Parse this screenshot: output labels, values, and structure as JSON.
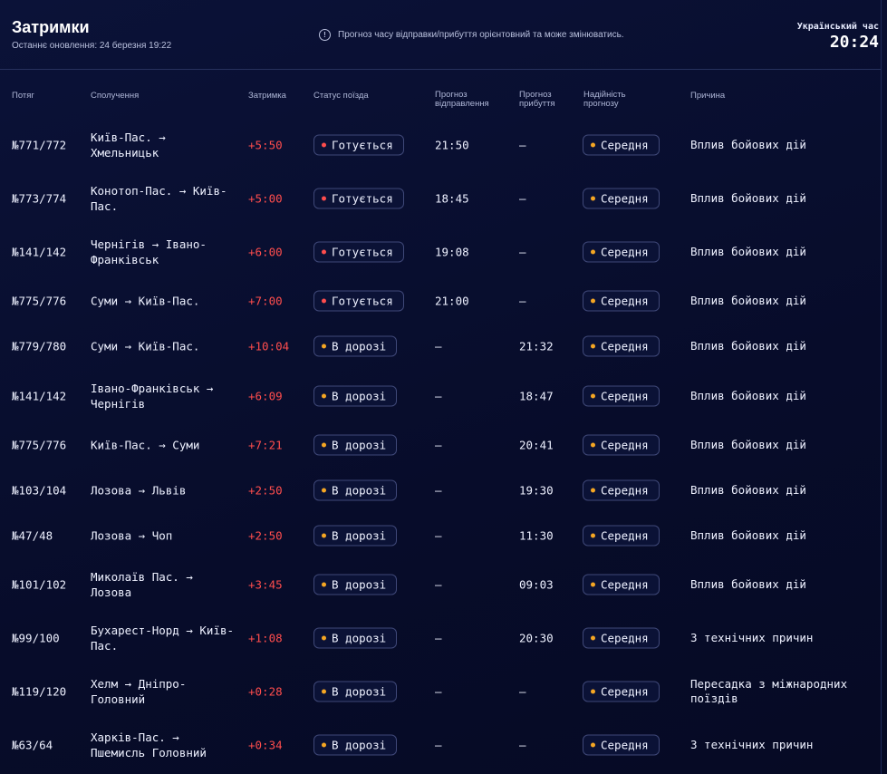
{
  "header": {
    "title": "Затримки",
    "updated": "Останнє оновлення: 24 березня 19:22",
    "notice": "Прогноз часу відправки/прибуття орієнтовний та може змінюватись.",
    "clock_label": "Український час",
    "clock_time": "20:24"
  },
  "columns": {
    "train": "Потяг",
    "route": "Сполучення",
    "delay": "Затримка",
    "status": "Статус поїзда",
    "departure": "Прогноз відправлення",
    "arrival": "Прогноз прибуття",
    "reliability": "Надійність прогнозу",
    "reason": "Причина"
  },
  "colors": {
    "status_preparing_dot": "#ff4d4d",
    "status_enroute_dot": "#f5a623",
    "reliability_dot": "#f5a623",
    "delay_text": "#ff4d4d",
    "background": "#070c2a"
  },
  "rows": [
    {
      "train": "№771/772",
      "route": "Київ-Пас. → Хмельницьк",
      "delay": "+5:50",
      "status": "Готується",
      "status_type": "preparing",
      "departure": "21:50",
      "arrival": "—",
      "reliability": "Середня",
      "reason": "Вплив бойових дій"
    },
    {
      "train": "№773/774",
      "route": "Конотоп-Пас. → Київ-Пас.",
      "delay": "+5:00",
      "status": "Готується",
      "status_type": "preparing",
      "departure": "18:45",
      "arrival": "—",
      "reliability": "Середня",
      "reason": "Вплив бойових дій"
    },
    {
      "train": "№141/142",
      "route": "Чернігів → Івано-Франківськ",
      "delay": "+6:00",
      "status": "Готується",
      "status_type": "preparing",
      "departure": "19:08",
      "arrival": "—",
      "reliability": "Середня",
      "reason": "Вплив бойових дій"
    },
    {
      "train": "№775/776",
      "route": "Суми → Київ-Пас.",
      "delay": "+7:00",
      "status": "Готується",
      "status_type": "preparing",
      "departure": "21:00",
      "arrival": "—",
      "reliability": "Середня",
      "reason": "Вплив бойових дій"
    },
    {
      "train": "№779/780",
      "route": "Суми → Київ-Пас.",
      "delay": "+10:04",
      "status": "В дорозі",
      "status_type": "enroute",
      "departure": "—",
      "arrival": "21:32",
      "reliability": "Середня",
      "reason": "Вплив бойових дій"
    },
    {
      "train": "№141/142",
      "route": "Івано-Франківськ → Чернігів",
      "delay": "+6:09",
      "status": "В дорозі",
      "status_type": "enroute",
      "departure": "—",
      "arrival": "18:47",
      "reliability": "Середня",
      "reason": "Вплив бойових дій"
    },
    {
      "train": "№775/776",
      "route": "Київ-Пас. → Суми",
      "delay": "+7:21",
      "status": "В дорозі",
      "status_type": "enroute",
      "departure": "—",
      "arrival": "20:41",
      "reliability": "Середня",
      "reason": "Вплив бойових дій"
    },
    {
      "train": "№103/104",
      "route": "Лозова → Львів",
      "delay": "+2:50",
      "status": "В дорозі",
      "status_type": "enroute",
      "departure": "—",
      "arrival": "19:30",
      "reliability": "Середня",
      "reason": "Вплив бойових дій"
    },
    {
      "train": "№47/48",
      "route": "Лозова → Чоп",
      "delay": "+2:50",
      "status": "В дорозі",
      "status_type": "enroute",
      "departure": "—",
      "arrival": "11:30",
      "reliability": "Середня",
      "reason": "Вплив бойових дій"
    },
    {
      "train": "№101/102",
      "route": "Миколаїв Пас. → Лозова",
      "delay": "+3:45",
      "status": "В дорозі",
      "status_type": "enroute",
      "departure": "—",
      "arrival": "09:03",
      "reliability": "Середня",
      "reason": "Вплив бойових дій"
    },
    {
      "train": "№99/100",
      "route": "Бухарест-Норд → Київ-Пас.",
      "delay": "+1:08",
      "status": "В дорозі",
      "status_type": "enroute",
      "departure": "—",
      "arrival": "20:30",
      "reliability": "Середня",
      "reason": "З технічних причин"
    },
    {
      "train": "№119/120",
      "route": "Хелм → Дніпро-Головний",
      "delay": "+0:28",
      "status": "В дорозі",
      "status_type": "enroute",
      "departure": "—",
      "arrival": "—",
      "reliability": "Середня",
      "reason": "Пересадка з міжнародних поїздів"
    },
    {
      "train": "№63/64",
      "route": "Харків-Пас. → Пшемисль Головний",
      "delay": "+0:34",
      "status": "В дорозі",
      "status_type": "enroute",
      "departure": "—",
      "arrival": "—",
      "reliability": "Середня",
      "reason": "З технічних причин"
    }
  ]
}
